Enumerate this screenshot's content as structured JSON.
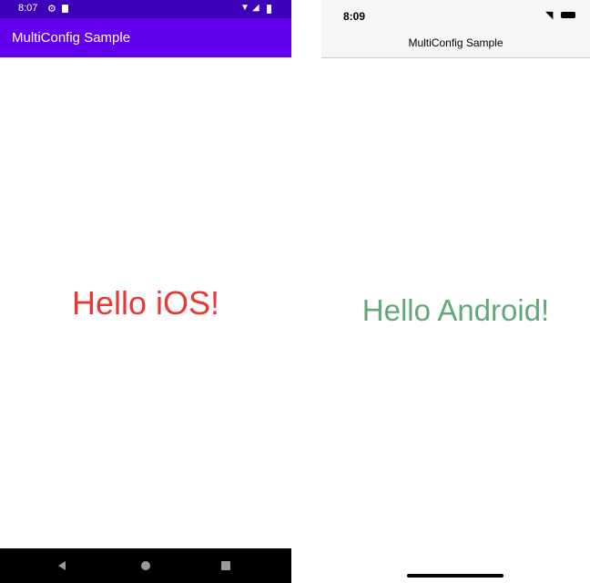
{
  "android": {
    "status": {
      "time": "8:07",
      "icons": [
        "gear-icon",
        "sim-card-icon",
        "wifi-icon",
        "signal-icon",
        "battery-icon"
      ]
    },
    "toolbar": {
      "title": "MultiConfig Sample"
    },
    "content": {
      "greeting": "Hello iOS!",
      "greeting_color": "#e53935"
    },
    "nav": [
      "back-icon",
      "home-icon",
      "recents-icon"
    ],
    "colors": {
      "status_bar": "#3d00b8",
      "toolbar": "#6200ee"
    }
  },
  "ios": {
    "status": {
      "time": "8:09",
      "icons": [
        "wifi-icon",
        "battery-icon"
      ]
    },
    "nav": {
      "title": "MultiConfig Sample"
    },
    "content": {
      "greeting": "Hello Android!",
      "greeting_color": "#63a77a"
    }
  }
}
